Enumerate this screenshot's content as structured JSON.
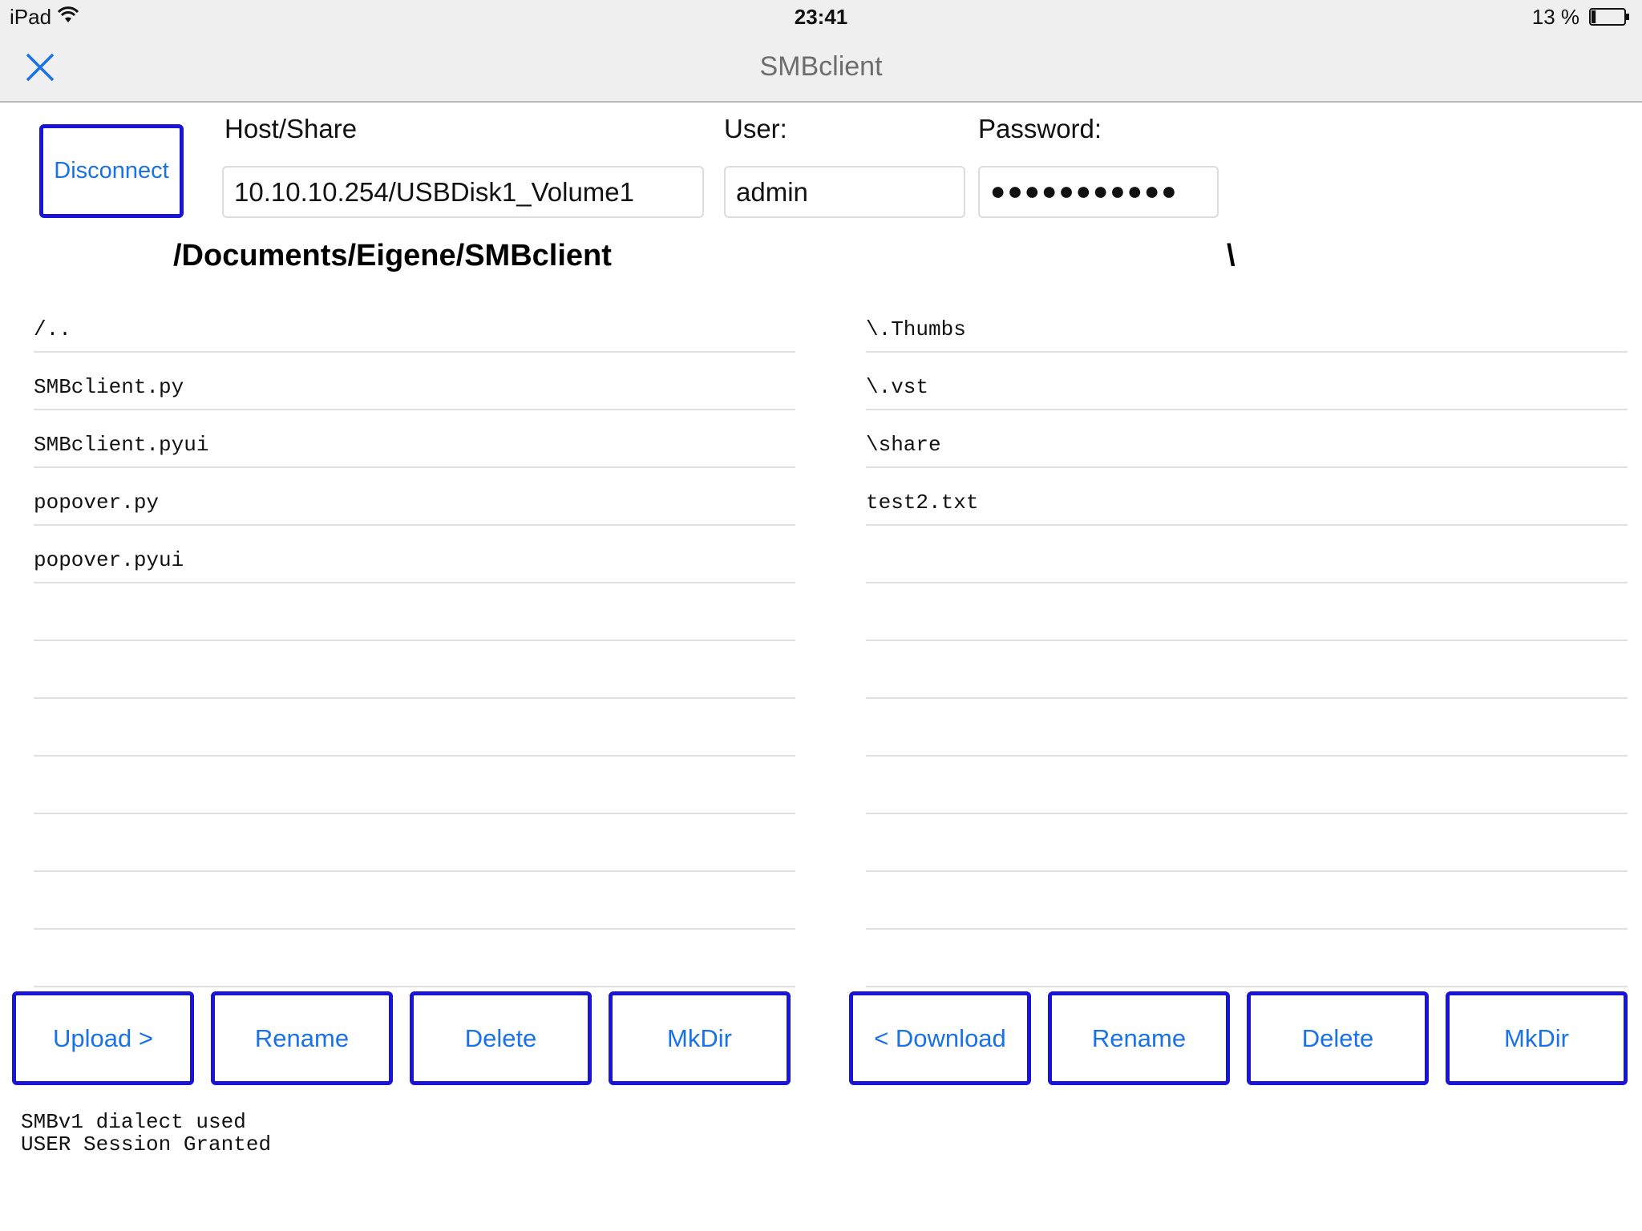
{
  "status_bar": {
    "device": "iPad",
    "time": "23:41",
    "battery": "13 %",
    "battery_level": 0.13
  },
  "nav": {
    "title": "SMBclient"
  },
  "connection": {
    "disconnect_label": "Disconnect",
    "host_label": "Host/Share",
    "host_value": "10.10.10.254/USBDisk1_Volume1",
    "user_label": "User:",
    "user_value": "admin",
    "password_label": "Password:",
    "password_masked": "●●●●●●●●●●●"
  },
  "local": {
    "path": "/Documents/Eigene/SMBclient",
    "files": [
      "/..",
      "SMBclient.py",
      "SMBclient.pyui",
      "popover.py",
      "popover.pyui",
      "",
      "",
      "",
      "",
      "",
      "",
      ""
    ],
    "buttons": {
      "upload": "Upload >",
      "rename": "Rename",
      "delete": "Delete",
      "mkdir": "MkDir"
    }
  },
  "remote": {
    "path": "\\",
    "files": [
      "\\.Thumbs",
      "\\.vst",
      "\\share",
      "test2.txt",
      "",
      "",
      "",
      "",
      "",
      "",
      "",
      ""
    ],
    "buttons": {
      "download": "< Download",
      "rename": "Rename",
      "delete": "Delete",
      "mkdir": "MkDir"
    }
  },
  "log": {
    "lines": "SMBv1 dialect used\nUSER Session Granted"
  }
}
